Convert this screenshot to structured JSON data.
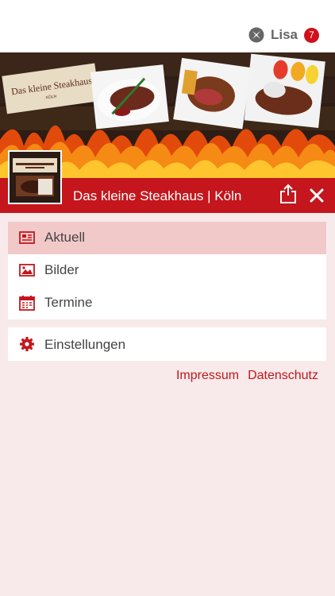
{
  "header": {
    "user_name": "Lisa",
    "badge_count": "7",
    "logo_icon": "app-logo-icon"
  },
  "hero": {
    "banner_text": "Das kleine Steakhaus",
    "banner_subtext": "KÖLN"
  },
  "titlebar": {
    "title": "Das kleine Steakhaus | Köln",
    "share_icon": "share-icon",
    "close_icon": "close-icon"
  },
  "menu": {
    "items": [
      {
        "label": "Aktuell",
        "icon": "newspaper-icon",
        "active": true
      },
      {
        "label": "Bilder",
        "icon": "image-icon",
        "active": false
      },
      {
        "label": "Termine",
        "icon": "calendar-icon",
        "active": false
      }
    ]
  },
  "settings": {
    "label": "Einstellungen",
    "icon": "gear-icon"
  },
  "footer": {
    "impressum": "Impressum",
    "datenschutz": "Datenschutz"
  },
  "colors": {
    "accent": "#c4161c",
    "background": "#f8eaea",
    "active_item": "#f2c9c9"
  }
}
